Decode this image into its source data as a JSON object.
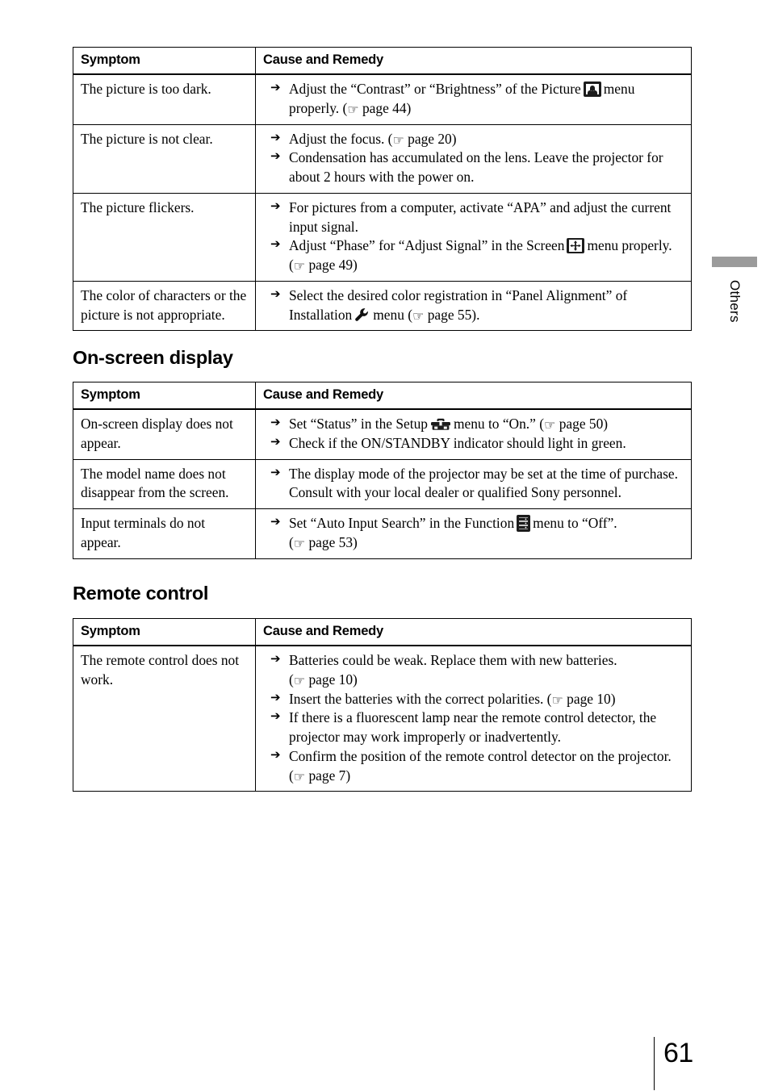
{
  "page": {
    "number": "61",
    "side_tab_label": "Others"
  },
  "columns": {
    "symptom": "Symptom",
    "cause_and_remedy": "Cause and Remedy"
  },
  "sections": [
    {
      "heading": "",
      "rows": [
        {
          "symptom": "The picture is too dark.",
          "remedies": [
            {
              "pre": "Adjust the “Contrast” or “Brightness” of the Picture",
              "icon": "picture-menu-icon",
              "post": "menu properly. (",
              "hand": "☞",
              "ref": "page 44)"
            }
          ]
        },
        {
          "symptom": "The picture is not clear.",
          "remedies": [
            {
              "pre": "Adjust the focus. (",
              "icon": "",
              "post": "",
              "hand": "☞",
              "ref": "page 20)"
            },
            {
              "pre": "Condensation has accumulated on the lens. Leave the projector for about 2 hours with the power on.",
              "icon": "",
              "post": "",
              "hand": "",
              "ref": ""
            }
          ]
        },
        {
          "symptom": "The picture flickers.",
          "remedies": [
            {
              "pre": "For pictures from a computer, activate “APA” and adjust the current input signal.",
              "icon": "",
              "post": "",
              "hand": "",
              "ref": ""
            },
            {
              "pre": "Adjust “Phase” for “Adjust Signal” in the Screen",
              "icon": "screen-menu-icon",
              "post": "menu properly. (",
              "hand": "☞",
              "ref": "page 49)"
            }
          ]
        },
        {
          "symptom": "The color of characters or the picture is not appropriate.",
          "remedies": [
            {
              "pre": "Select the desired color registration in “Panel Alignment” of Installation",
              "icon": "wrench-icon",
              "post": "menu (",
              "hand": "☞",
              "ref": "page 55)."
            }
          ]
        }
      ]
    },
    {
      "heading": "On-screen display",
      "rows": [
        {
          "symptom": "On-screen display does not appear.",
          "remedies": [
            {
              "pre": "Set “Status” in the Setup",
              "icon": "toolbox-icon",
              "post": "menu to “On.” (",
              "hand": "☞",
              "ref": "page 50)"
            },
            {
              "pre": "Check if the ON/STANDBY indicator should light in green.",
              "icon": "",
              "post": "",
              "hand": "",
              "ref": ""
            }
          ]
        },
        {
          "symptom": "The model name does not disappear from the screen.",
          "remedies": [
            {
              "pre": "The display mode of the projector may be set at the time of purchase. Consult with your local dealer or qualified Sony personnel.",
              "icon": "",
              "post": "",
              "hand": "",
              "ref": ""
            }
          ]
        },
        {
          "symptom": "Input terminals do not appear.",
          "remedies": [
            {
              "pre": "Set “Auto Input Search” in the Function",
              "icon": "function-menu-icon",
              "post": "menu to “Off”. (",
              "hand": "☞",
              "ref": "page 53)"
            }
          ]
        }
      ]
    },
    {
      "heading": "Remote control",
      "rows": [
        {
          "symptom": "The remote control does not work.",
          "remedies": [
            {
              "pre": "Batteries could be weak. Replace them with new batteries. (",
              "icon": "",
              "post": "",
              "hand": "☞",
              "ref": "page 10)"
            },
            {
              "pre": "Insert the batteries with the correct polarities. (",
              "icon": "",
              "post": "",
              "hand": "☞",
              "ref": "page 10)"
            },
            {
              "pre": "If there is a fluorescent lamp near the remote control detector, the projector may work improperly or inadvertently.",
              "icon": "",
              "post": "",
              "hand": "",
              "ref": ""
            },
            {
              "pre": "Confirm the position of the remote control detector on the projector. (",
              "icon": "",
              "post": "",
              "hand": "☞",
              "ref": "page 7)"
            }
          ]
        }
      ]
    }
  ],
  "icons": {
    "arrow": "➔",
    "hand": "☞"
  },
  "colors": {
    "text": "#000000",
    "rule": "#000000",
    "tab_bar": "#9b9b9b",
    "icon_box": "#1c1c1c",
    "background": "#ffffff"
  }
}
